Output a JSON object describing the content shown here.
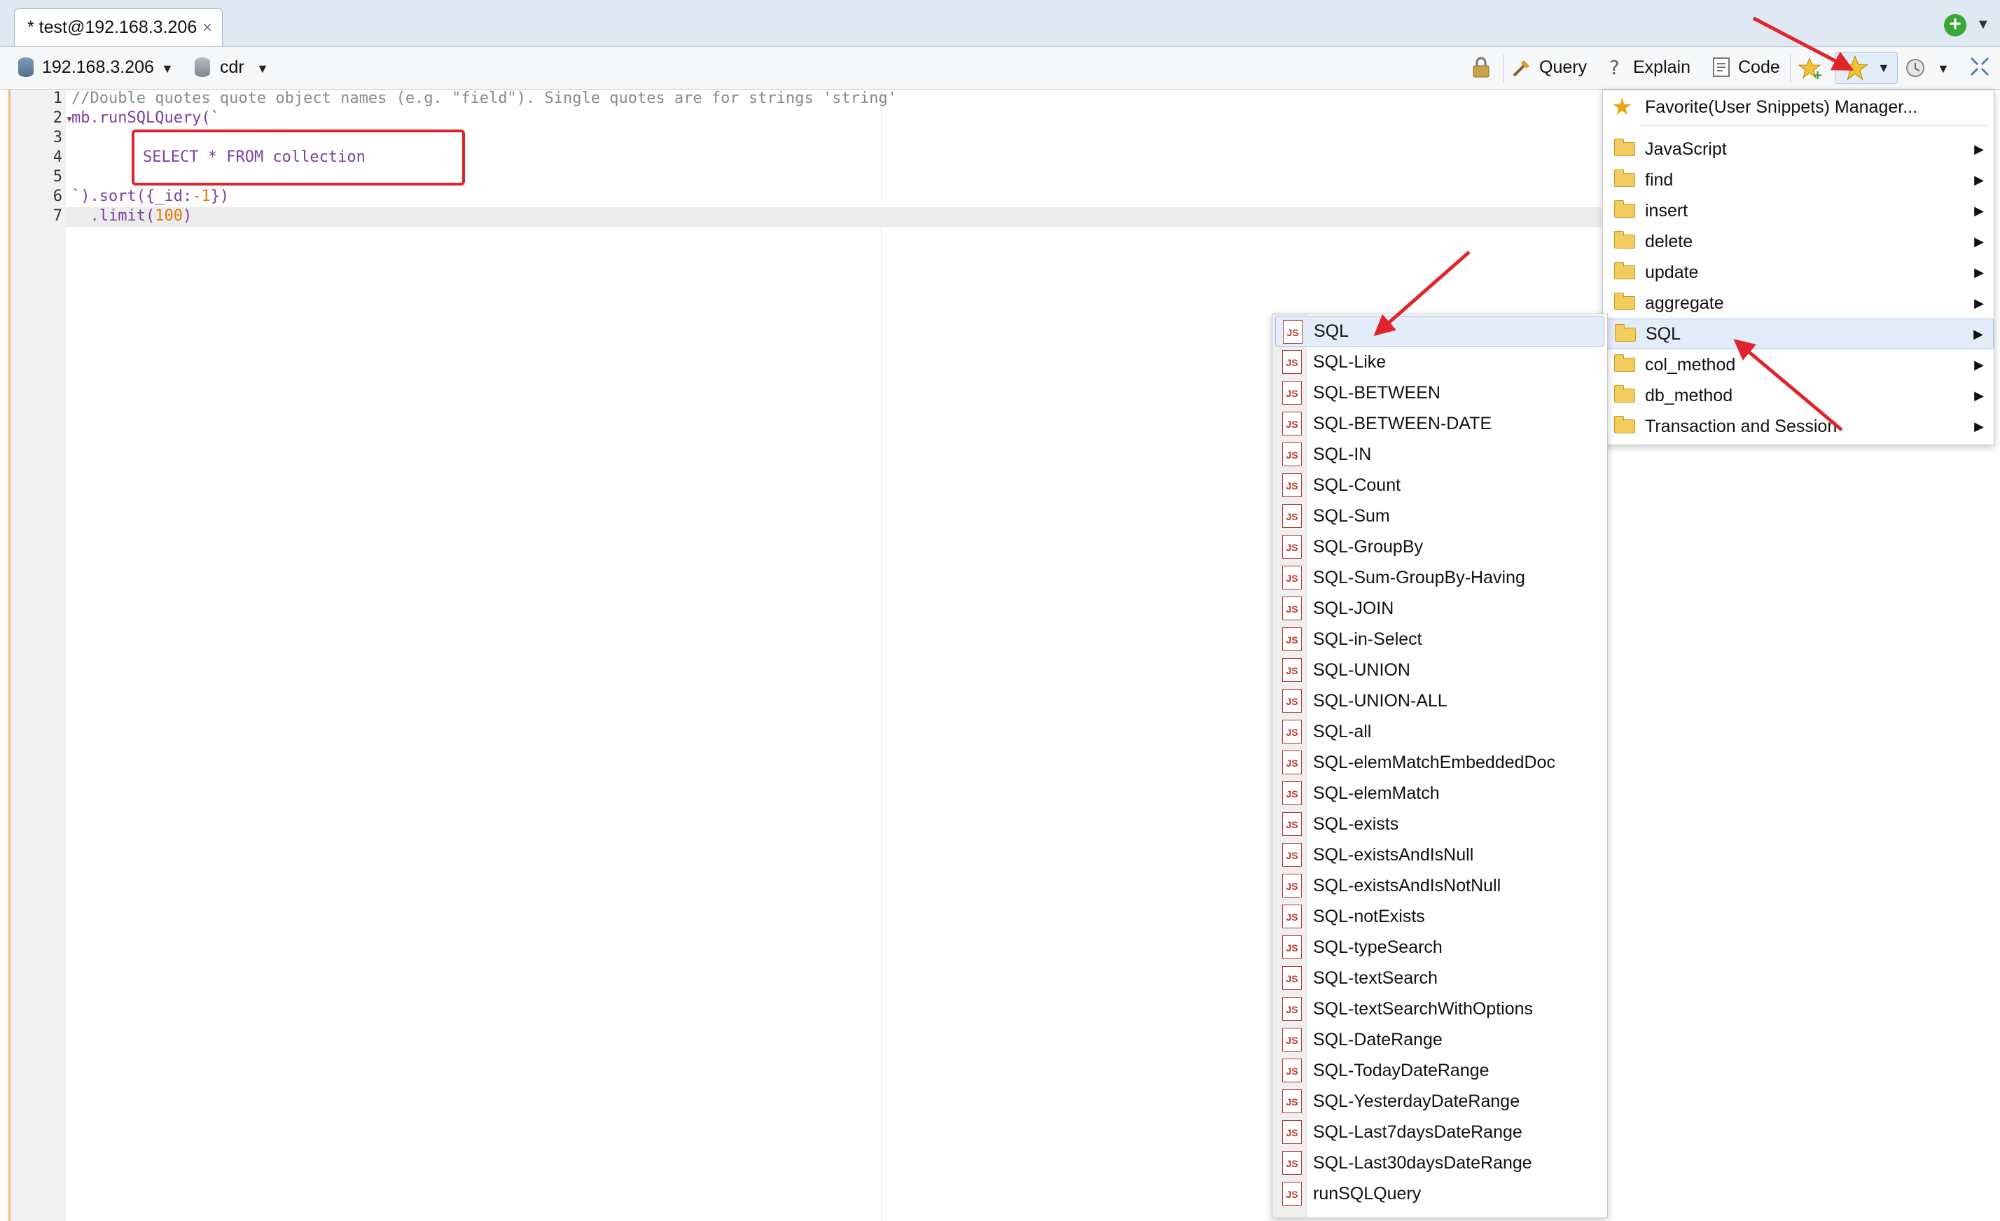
{
  "tab": {
    "title": "* test@192.168.3.206",
    "close": "×"
  },
  "toolbar": {
    "server": "192.168.3.206",
    "database": "cdr",
    "query_label": "Query",
    "explain_label": "Explain",
    "code_label": "Code"
  },
  "editor": {
    "line_numbers": [
      "1",
      "2",
      "3",
      "4",
      "5",
      "6",
      "7"
    ],
    "line1_comment": "//Double quotes quote object names (e.g. \"field\"). Single quotes are for strings 'string'",
    "line2_prefix": "mb.runSQLQuery(`",
    "line4_sql": "SELECT * FROM collection",
    "line6_a": "`).sort({_id:",
    "line6_num": "-1",
    "line6_b": "})",
    "line7_a": "  .limit(",
    "line7_num": "100",
    "line7_b": ")"
  },
  "favorites_menu": {
    "manager": "Favorite(User Snippets) Manager...",
    "folders": [
      "JavaScript",
      "find",
      "insert",
      "delete",
      "update",
      "aggregate",
      "SQL",
      "col_method",
      "db_method",
      "Transaction and Session"
    ],
    "selected": "SQL"
  },
  "sql_menu": {
    "items": [
      "SQL",
      "SQL-Like",
      "SQL-BETWEEN",
      "SQL-BETWEEN-DATE",
      "SQL-IN",
      "SQL-Count",
      "SQL-Sum",
      "SQL-GroupBy",
      "SQL-Sum-GroupBy-Having",
      "SQL-JOIN",
      "SQL-in-Select",
      "SQL-UNION",
      "SQL-UNION-ALL",
      "SQL-all",
      "SQL-elemMatchEmbeddedDoc",
      "SQL-elemMatch",
      "SQL-exists",
      "SQL-existsAndIsNull",
      "SQL-existsAndIsNotNull",
      "SQL-notExists",
      "SQL-typeSearch",
      "SQL-textSearch",
      "SQL-textSearchWithOptions",
      "SQL-DateRange",
      "SQL-TodayDateRange",
      "SQL-YesterdayDateRange",
      "SQL-Last7daysDateRange",
      "SQL-Last30daysDateRange",
      "runSQLQuery"
    ],
    "icon_text": "JS"
  },
  "colors": {
    "accent": "#e0242b",
    "selection": "#e3ecf9",
    "keyword": "#7b3fa0",
    "number": "#e8770a"
  }
}
